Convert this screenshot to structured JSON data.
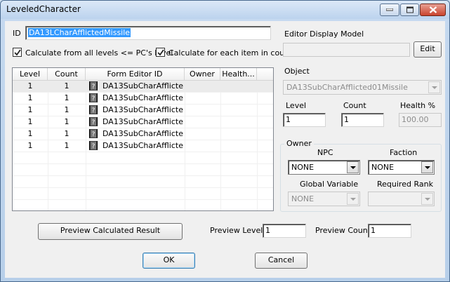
{
  "window": {
    "title": "LeveledCharacter"
  },
  "form": {
    "id_label": "ID",
    "id_value": "DA13LCharAfflictedMissile",
    "calc_all_levels_label": "Calculate from all levels <= PC's level",
    "calc_all_levels_checked": true,
    "calc_each_item_label": "Calculate for each item in count",
    "calc_each_item_checked": true
  },
  "list": {
    "columns": [
      "Level",
      "Count",
      "Form Editor ID",
      "Owner",
      "Health..."
    ],
    "rows": [
      {
        "level": "1",
        "count": "1",
        "form_id": "DA13SubCharAfflicte...",
        "owner": "",
        "health": ""
      },
      {
        "level": "1",
        "count": "1",
        "form_id": "DA13SubCharAfflicte...",
        "owner": "",
        "health": ""
      },
      {
        "level": "1",
        "count": "1",
        "form_id": "DA13SubCharAfflicte...",
        "owner": "",
        "health": ""
      },
      {
        "level": "1",
        "count": "1",
        "form_id": "DA13SubCharAfflicte...",
        "owner": "",
        "health": ""
      },
      {
        "level": "1",
        "count": "1",
        "form_id": "DA13SubCharAfflicte...",
        "owner": "",
        "health": ""
      },
      {
        "level": "1",
        "count": "1",
        "form_id": "DA13SubCharAfflicte...",
        "owner": "",
        "health": ""
      }
    ]
  },
  "display_model": {
    "label": "Editor Display Model",
    "value": "",
    "edit_label": "Edit"
  },
  "object": {
    "label": "Object",
    "value": "DA13SubCharAfflicted01Missile",
    "level_label": "Level",
    "level_value": "1",
    "count_label": "Count",
    "count_value": "1",
    "health_label": "Health %",
    "health_value": "100.00"
  },
  "owner": {
    "group_label": "Owner",
    "npc_label": "NPC",
    "npc_value": "NONE",
    "faction_label": "Faction",
    "faction_value": "NONE",
    "global_var_label": "Global Variable",
    "global_var_value": "NONE",
    "required_rank_label": "Required Rank",
    "required_rank_value": ""
  },
  "preview": {
    "button_label": "Preview Calculated Result",
    "level_label": "Preview Level",
    "level_value": "1",
    "count_label": "Preview Count",
    "count_value": "1"
  },
  "footer": {
    "ok_label": "OK",
    "cancel_label": "Cancel"
  }
}
